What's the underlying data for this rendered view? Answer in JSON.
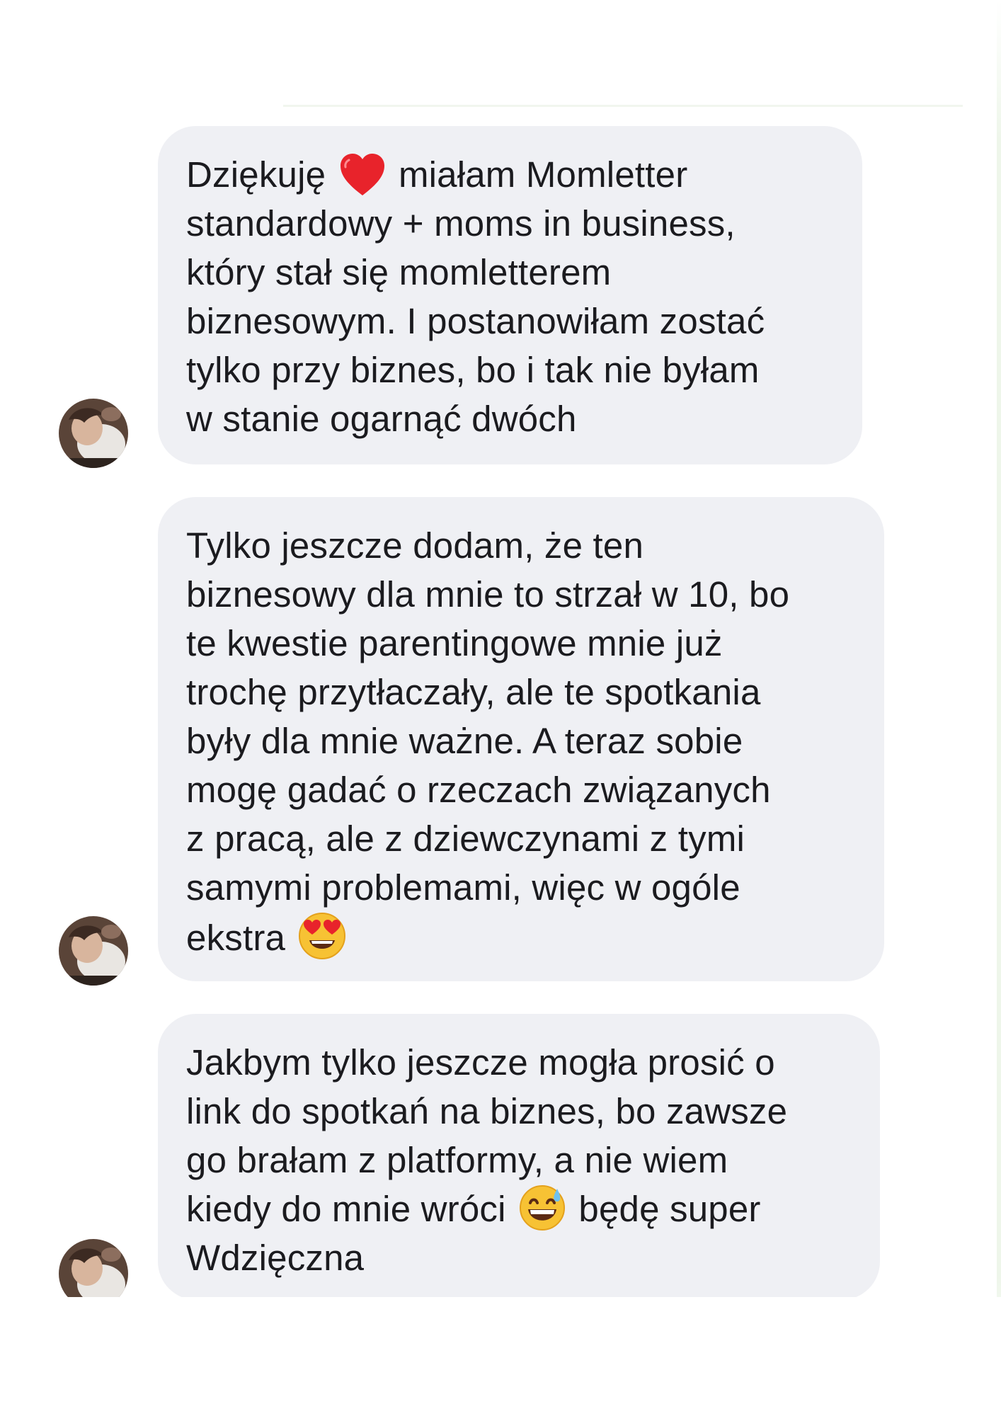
{
  "messages": [
    {
      "lines": [
        {
          "before": "Dziękuję",
          "emoji": "red-heart",
          "after": "miałam Momletter"
        },
        {
          "text": "standardowy + moms in business,"
        },
        {
          "text": "który stał się momletterem"
        },
        {
          "text": "biznesowym. I postanowiłam zostać"
        },
        {
          "text": "tylko przy biznes, bo i tak nie byłam"
        },
        {
          "text": "w stanie ogarnąć dwóch"
        }
      ]
    },
    {
      "lines": [
        {
          "text": "Tylko jeszcze dodam, że ten"
        },
        {
          "text": "biznesowy dla mnie to strzał w 10, bo"
        },
        {
          "text": "te kwestie parentingowe mnie już"
        },
        {
          "text": "trochę przytłaczały, ale te spotkania"
        },
        {
          "text": "były dla mnie ważne. A teraz sobie"
        },
        {
          "text": "mogę gadać o rzeczach związanych"
        },
        {
          "text": "z pracą, ale z dziewczynami z tymi"
        },
        {
          "text": "samymi problemami, więc w ogóle"
        },
        {
          "before": "ekstra",
          "emoji": "heart-eyes-face",
          "after": ""
        }
      ]
    },
    {
      "lines": [
        {
          "text": "Jakbym tylko jeszcze mogła prosić o"
        },
        {
          "text": "link do spotkań na biznes, bo zawsze"
        },
        {
          "text": "go brałam z platformy, a nie wiem"
        },
        {
          "before": "kiedy do mnie wróci",
          "emoji": "grinning-sweat-face",
          "after": "będę super"
        },
        {
          "text": "Wdzięczna"
        }
      ]
    }
  ],
  "colors": {
    "bubble_bg": "#eff0f4",
    "text": "#1b1b1f",
    "page_bg": "#ffffff"
  }
}
